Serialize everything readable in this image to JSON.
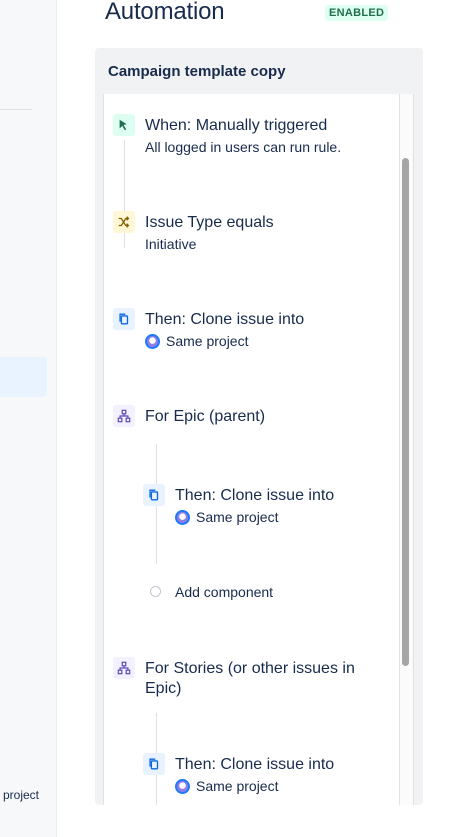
{
  "sidebar": {
    "footer_text": "project"
  },
  "header": {
    "title": "Automation",
    "status": "ENABLED"
  },
  "rule": {
    "name": "Campaign template copy",
    "steps": [
      {
        "kind": "trigger",
        "icon": "cursor-click-icon",
        "title": "When: Manually triggered",
        "subtitle": "All logged in users can run rule."
      },
      {
        "kind": "condition",
        "icon": "shuffle-icon",
        "title": "Issue Type equals",
        "subtitle": "Initiative"
      },
      {
        "kind": "action",
        "icon": "copy-icon",
        "title": "Then: Clone issue into",
        "subtitle": "Same project"
      },
      {
        "kind": "branch",
        "icon": "hierarchy-icon",
        "title": "For Epic (parent)"
      },
      {
        "kind": "action",
        "icon": "copy-icon",
        "title": "Then: Clone issue into",
        "subtitle": "Same project"
      },
      {
        "kind": "add",
        "title": "Add component"
      },
      {
        "kind": "branch",
        "icon": "hierarchy-icon",
        "title": "For Stories (or other issues in Epic)"
      },
      {
        "kind": "action",
        "icon": "copy-icon",
        "title": "Then: Clone issue into",
        "subtitle": "Same project"
      }
    ]
  },
  "colors": {
    "trigger": "#dcfff1",
    "condition": "#fff7d6",
    "action": "#e9f2ff",
    "branch": "#f3f0ff",
    "enabled": "#216e4e"
  }
}
